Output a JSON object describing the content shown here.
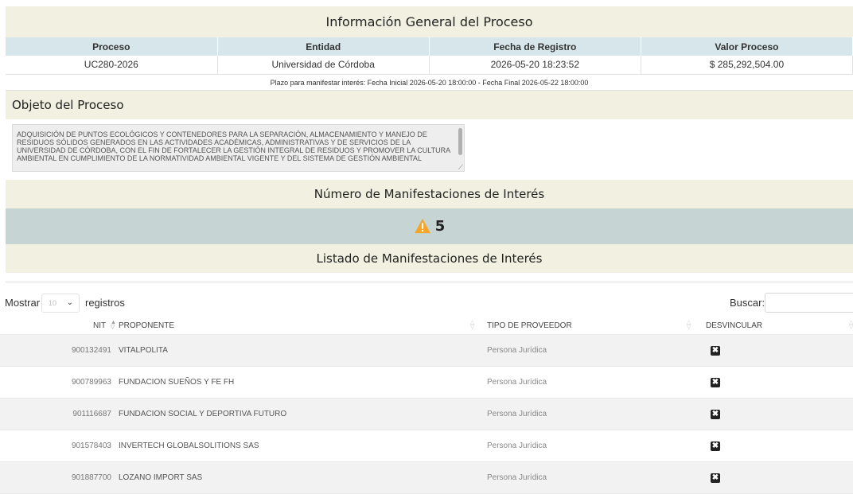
{
  "general": {
    "title": "Información General del Proceso",
    "headers": [
      "Proceso",
      "Entidad",
      "Fecha de Registro",
      "Valor Proceso"
    ],
    "values": [
      "UC280-2026",
      "Universidad de Córdoba",
      "2026-05-20 18:23:52",
      "$ 285,292,504.00"
    ],
    "plazo": "Plazo para manifestar interés: Fecha Inicial 2026-05-20 18:00:00 - Fecha Final 2026-05-22 18:00:00"
  },
  "objeto": {
    "title": "Objeto del Proceso",
    "text": "ADQUISICIÓN DE PUNTOS ECOLÓGICOS Y CONTENEDORES PARA LA SEPARACIÓN, ALMACENAMIENTO Y MANEJO DE RESIDUOS SÓLIDOS GENERADOS EN LAS ACTIVIDADES ACADÉMICAS, ADMINISTRATIVAS Y DE SERVICIOS DE LA UNIVERSIDAD DE CÓRDOBA, CON EL FIN DE FORTALECER LA GESTIÓN INTEGRAL DE RESIDUOS Y PROMOVER LA CULTURA AMBIENTAL EN CUMPLIMIENTO DE LA NORMATIVIDAD AMBIENTAL VIGENTE Y DEL SISTEMA DE GESTIÓN AMBIENTAL"
  },
  "manifestaciones": {
    "count_title": "Número de Manifestaciones de Interés",
    "count": "5",
    "count_icon": "warning-icon",
    "list_title": "Listado de Manifestaciones de Interés"
  },
  "table_controls": {
    "show_label": "Mostrar",
    "page_size": "10",
    "records_label": "registros",
    "search_label": "Buscar:",
    "search_value": ""
  },
  "table": {
    "columns": [
      "NIT",
      "PROPONENTE",
      "TIPO DE PROVEEDOR",
      "DESVINCULAR"
    ],
    "rows": [
      {
        "nit": "900132491",
        "proponente": "VITALPOLITA",
        "tipo": "Persona Jurídica"
      },
      {
        "nit": "900789963",
        "proponente": "FUNDACION SUEÑOS Y FE FH",
        "tipo": "Persona Jurídica"
      },
      {
        "nit": "901116687",
        "proponente": "FUNDACION SOCIAL Y DEPORTIVA FUTURO",
        "tipo": "Persona Jurídica"
      },
      {
        "nit": "901578403",
        "proponente": "INVERTECH GLOBALSOLITIONS SAS",
        "tipo": "Persona Jurídica"
      },
      {
        "nit": "901887700",
        "proponente": "LOZANO IMPORT SAS",
        "tipo": "Persona Jurídica"
      }
    ],
    "delete_glyph": "✖"
  },
  "colors": {
    "header_band": "#f2f1e1",
    "table_header": "#d7e6ea",
    "count_band": "#c6d4d4",
    "warning": "#f4a62a"
  }
}
